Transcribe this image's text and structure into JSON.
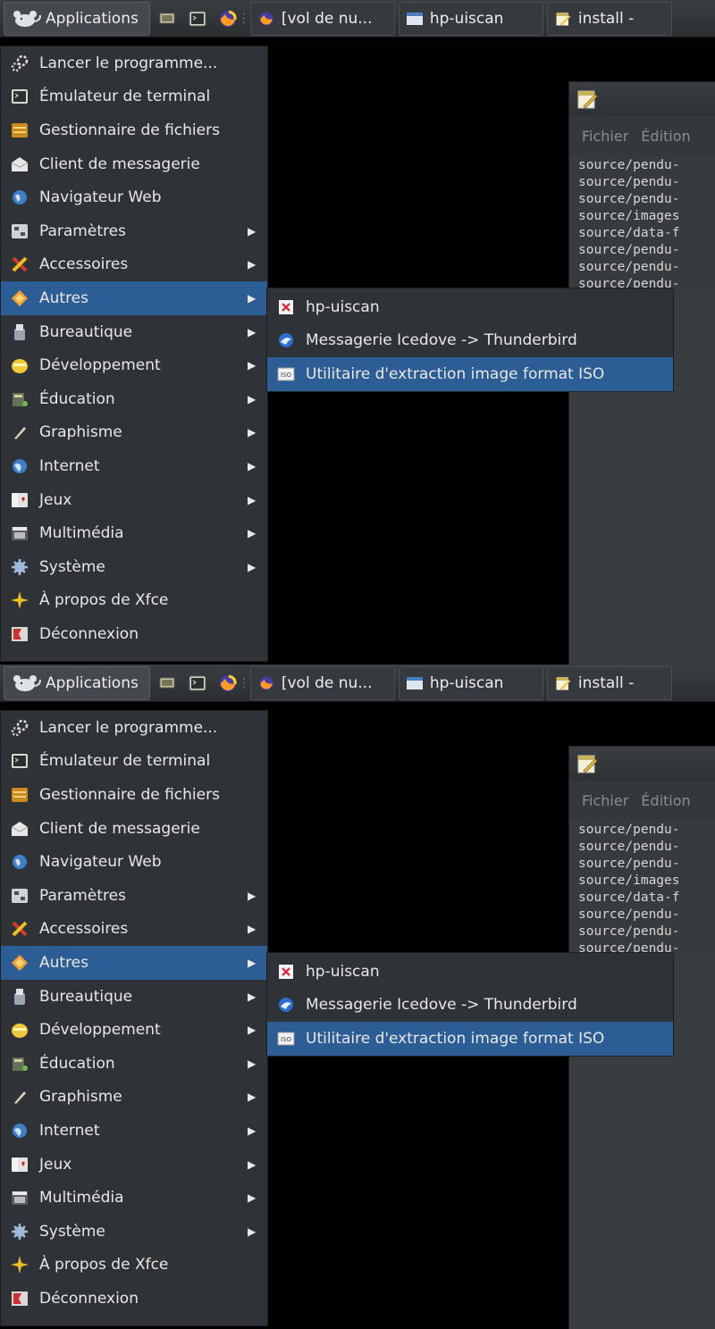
{
  "panel": {
    "applications_label": "Applications",
    "tasks": [
      {
        "label": "[vol de nu..."
      },
      {
        "label": "hp-uiscan"
      },
      {
        "label": "install -"
      }
    ]
  },
  "editor": {
    "menu": [
      "Fichier",
      "Édition"
    ],
    "lines": [
      "source/pendu-",
      "source/pendu-",
      "source/pendu-",
      "source/images",
      "source/data-f",
      "source/pendu-",
      "source/pendu-",
      "source/pendu-"
    ]
  },
  "menu": {
    "items": [
      {
        "label": "Lancer le programme...",
        "icon": "run-icon"
      },
      {
        "label": "Émulateur de terminal",
        "icon": "terminal-icon"
      },
      {
        "label": "Gestionnaire de fichiers",
        "icon": "file-manager-icon"
      },
      {
        "label": "Client de messagerie",
        "icon": "mail-icon"
      },
      {
        "label": "Navigateur Web",
        "icon": "web-browser-icon"
      },
      {
        "label": "Paramètres",
        "icon": "settings-icon"
      },
      {
        "label": "Accessoires",
        "icon": "accessories-icon"
      },
      {
        "label": "Autres",
        "icon": "others-icon"
      },
      {
        "label": "Bureautique",
        "icon": "office-icon"
      },
      {
        "label": "Développement",
        "icon": "development-icon"
      },
      {
        "label": "Éducation",
        "icon": "education-icon"
      },
      {
        "label": "Graphisme",
        "icon": "graphics-icon"
      },
      {
        "label": "Internet",
        "icon": "internet-icon"
      },
      {
        "label": "Jeux",
        "icon": "games-icon"
      },
      {
        "label": "Multimédia",
        "icon": "multimedia-icon"
      },
      {
        "label": "Système",
        "icon": "system-icon"
      },
      {
        "label": "À propos de Xfce",
        "icon": "about-xfce-icon"
      },
      {
        "label": "Déconnexion",
        "icon": "logout-icon"
      }
    ]
  },
  "submenu": {
    "items": [
      {
        "label": "hp-uiscan",
        "icon": "hp-uiscan-icon"
      },
      {
        "label": "Messagerie Icedove -> Thunderbird",
        "icon": "icedove-icon"
      },
      {
        "label": "Utilitaire d'extraction image format ISO",
        "icon": "iso-icon"
      }
    ]
  },
  "colors": {
    "selection": "#2c5d94",
    "menu_bg": "#2f3236",
    "panel_bg": "#2b2e31"
  }
}
